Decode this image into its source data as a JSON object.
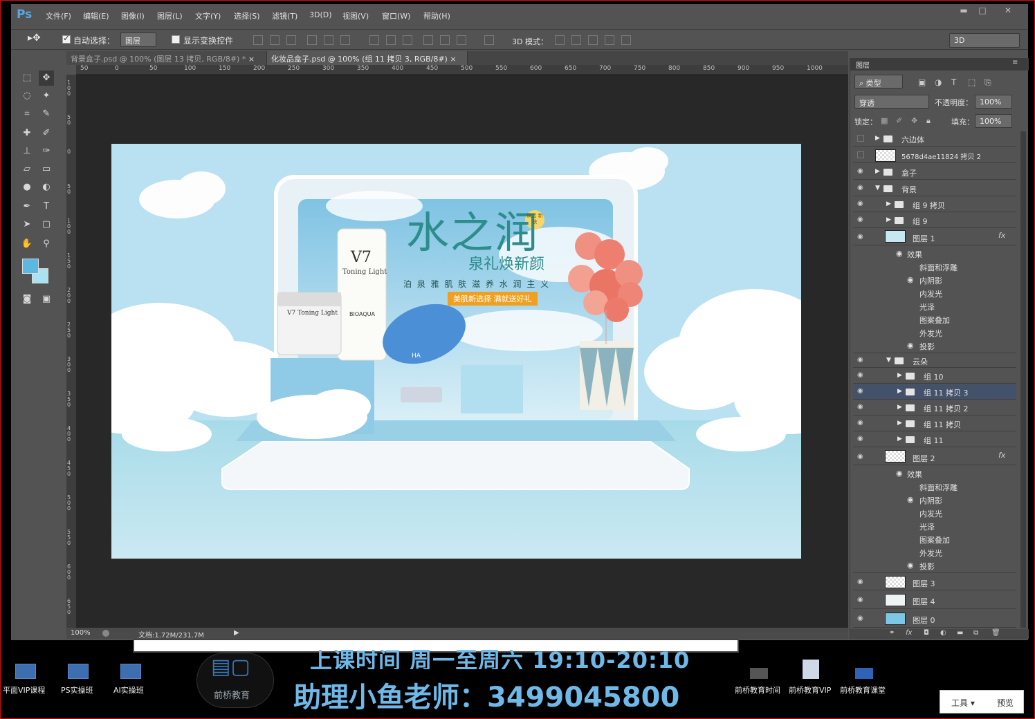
{
  "menubar": {
    "logo": "Ps",
    "items": [
      "文件(F)",
      "编辑(E)",
      "图像(I)",
      "图层(L)",
      "文字(Y)",
      "选择(S)",
      "滤镜(T)",
      "3D(D)",
      "视图(V)",
      "窗口(W)",
      "帮助(H)"
    ]
  },
  "options": {
    "auto_select_label": "自动选择：",
    "auto_select_value": "图层",
    "show_transform_label": "显示变换控件",
    "mode3d_label": "3D 模式：",
    "workspace_value": "3D"
  },
  "tabs": [
    {
      "label": "背景盒子.psd @ 100% (图层 13 拷贝, RGB/8#) *",
      "close": "×"
    },
    {
      "label": "化妆品盒子.psd @ 100% (组 11 拷贝 3, RGB/8#)",
      "close": "×"
    }
  ],
  "ruler_top": [
    "50",
    "0",
    "50",
    "100",
    "150",
    "200",
    "250",
    "300",
    "350",
    "400",
    "450",
    "500",
    "550",
    "600",
    "650",
    "700",
    "750",
    "800",
    "850",
    "900",
    "950",
    "1000"
  ],
  "ruler_left": [
    "100",
    "50",
    "0",
    "50",
    "100",
    "150",
    "200",
    "250",
    "300",
    "350",
    "400",
    "450",
    "500",
    "550",
    "600",
    "650"
  ],
  "status": {
    "zoom": "100%",
    "doc": "文档:1.72M/231.7M"
  },
  "artwork": {
    "title": "水之润",
    "subtitle": "泉礼焕新颜",
    "slogan": "泊 泉 雅 肌 肤 滋 养 水 润 主 义",
    "banner": "美肌新选择 满就送好礼",
    "badge": "焕活 新肤",
    "product_tube_big": "V7",
    "product_tube_small": "Toning Light",
    "product_brand": "BIOAQUA",
    "product_jar": "V7 Toning Light",
    "product_blue": "HA"
  },
  "layers_panel": {
    "title": "图层",
    "filter_label": "类型",
    "blend_mode": "穿透",
    "opacity_label": "不透明度：",
    "opacity_value": "100%",
    "lock_label": "锁定：",
    "fill_label": "填充：",
    "fill_value": "100%",
    "effects_label": "效果",
    "rows": [
      {
        "name": "六边体",
        "type": "folder"
      },
      {
        "name": "5678d4ae11824 拷贝 2",
        "type": "image"
      },
      {
        "name": "盒子",
        "type": "folder"
      },
      {
        "name": "背景",
        "type": "folder-open"
      },
      {
        "name": "组 9 拷贝",
        "type": "folder"
      },
      {
        "name": "组 9",
        "type": "folder"
      },
      {
        "name": "图层 1",
        "type": "layer",
        "fx": "fx"
      },
      {
        "name": "云朵",
        "type": "folder-open"
      },
      {
        "name": "组 10",
        "type": "folder"
      },
      {
        "name": "组 11 拷贝 3",
        "type": "folder",
        "selected": true
      },
      {
        "name": "组 11 拷贝 2",
        "type": "folder"
      },
      {
        "name": "组 11 拷贝",
        "type": "folder"
      },
      {
        "name": "组 11",
        "type": "folder"
      },
      {
        "name": "图层 2",
        "type": "layer",
        "fx": "fx"
      },
      {
        "name": "图层 3",
        "type": "layer"
      },
      {
        "name": "图层 4",
        "type": "layer"
      },
      {
        "name": "图层 0",
        "type": "layer"
      }
    ],
    "effects_1": [
      "斜面和浮雕",
      "内阴影",
      "内发光",
      "光泽",
      "图案叠加",
      "外发光",
      "投影"
    ],
    "effects_2": [
      "斜面和浮雕",
      "内阴影",
      "内发光",
      "光泽",
      "图案叠加",
      "外发光",
      "投影"
    ]
  },
  "taskbar": {
    "items": [
      "平面VIP课程",
      "PS实操班",
      "AI实操班"
    ],
    "logo_text": "前桥教育",
    "schedule": "上课时间 周一至周六 19:10-20:10",
    "contact": "助理小鱼老师：3499045800",
    "right_items": [
      "前桥教育时间",
      "前桥教育VIP",
      "前桥教育课堂"
    ],
    "tools_label": "工具",
    "preview_label": "预览"
  },
  "colors": {
    "fg_swatch": "#5bb8e0",
    "bg_swatch": "#a9e2f0",
    "accent_text": "#2d8c8c",
    "banner": "#f0a01e"
  }
}
